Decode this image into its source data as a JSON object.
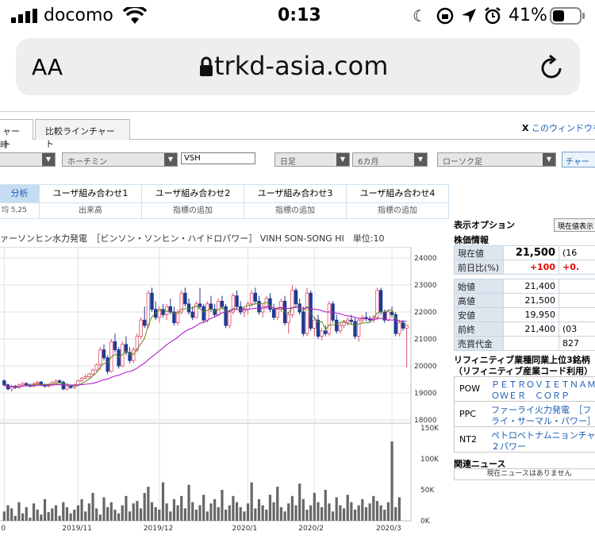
{
  "status": {
    "carrier": "docomo",
    "time": "0:13",
    "battery": "41%"
  },
  "browser": {
    "text_size": "AA",
    "host": "trkd-asia.com"
  },
  "page": {
    "tabs": [
      "ャート",
      "比較ラインチャート"
    ],
    "close_link": "このウィンドウを",
    "close_x": "X",
    "cut_label": "時",
    "market": "ホーチミン",
    "ticker": "VSH",
    "period": "日足",
    "range": "6カ月",
    "chart_style": "ローソク足",
    "chart_btn": "チャー",
    "indicator_tabs": [
      "分析",
      "ユーザ組み合わせ1",
      "ユーザ組み合わせ2",
      "ユーザ組み合わせ3",
      "ユーザ組み合わせ4"
    ],
    "indicator_sub": [
      "均 5,25",
      "出来高",
      "指標の追加",
      "指標の追加",
      "指標の追加"
    ],
    "chart_title": "ァーソンヒン水力発電　［ビンソン・ソンヒン・ハイドロパワー］ VINH SON-SONG HI　単位:10"
  },
  "side": {
    "display_options": "表示オプション",
    "current_value_btn": "現在値表示",
    "stock_info": "株価情報",
    "current_label": "現在値",
    "current_value": "21,500",
    "current_extra": "(16",
    "change_label": "前日比(%)",
    "change_value": "+100",
    "change_pct": "+0.",
    "rows": [
      {
        "k": "始値",
        "v": "21,400",
        "x": ""
      },
      {
        "k": "高値",
        "v": "21,500",
        "x": ""
      },
      {
        "k": "安値",
        "v": "19,950",
        "x": ""
      },
      {
        "k": "前終",
        "v": "21,400",
        "x": "(03"
      },
      {
        "k": "売買代金",
        "v": "",
        "x": "827"
      }
    ],
    "peers_title": "リフィニティブ業種同業上位3銘柄",
    "peers_sub": "（リフィニティブ産業コード利用）",
    "peers": [
      {
        "code": "POW",
        "name1": "ＰＥＴＲＯＶＩＥＴＮＡＭ",
        "name2": "ＯＷＥＲ　ＣＯＲＰ"
      },
      {
        "code": "PPC",
        "name1": "ファーライ火力発電　［フ",
        "name2": "ライ・サーマル・パワー］"
      },
      {
        "code": "NT2",
        "name1": "ペトロベトナムニョンチャ",
        "name2": "２パワー"
      }
    ],
    "news_title": "関連ニュース",
    "news_empty": "現在ニュースはありません"
  },
  "chart_data": {
    "type": "candlestick",
    "price_axis": {
      "ticks": [
        18000,
        19000,
        20000,
        21000,
        22000,
        23000,
        24000
      ],
      "labels": [
        "18000",
        "19000",
        "20000",
        "21000",
        "22000",
        "23000",
        "24000"
      ],
      "ylim": [
        18000,
        24000
      ]
    },
    "volume_axis": {
      "labels": [
        "0K",
        "50K",
        "100K",
        "150K"
      ],
      "ylim": [
        0,
        150000
      ]
    },
    "x_labels": [
      {
        "idx": 0,
        "label": "0"
      },
      {
        "idx": 20,
        "label": "2019/11"
      },
      {
        "idx": 42,
        "label": "2019/12"
      },
      {
        "idx": 66,
        "label": "2020/1"
      },
      {
        "idx": 84,
        "label": "2020/2"
      },
      {
        "idx": 105,
        "label": "2020/3"
      }
    ],
    "candles": [
      [
        19450,
        19500,
        19250,
        19300
      ],
      [
        19300,
        19350,
        19100,
        19150
      ],
      [
        19150,
        19300,
        19050,
        19250
      ],
      [
        19250,
        19300,
        19150,
        19200
      ],
      [
        19200,
        19350,
        19150,
        19300
      ],
      [
        19300,
        19400,
        19250,
        19350
      ],
      [
        19350,
        19400,
        19250,
        19300
      ],
      [
        19300,
        19350,
        19200,
        19250
      ],
      [
        19250,
        19400,
        19200,
        19350
      ],
      [
        19350,
        19450,
        19300,
        19400
      ],
      [
        19400,
        19450,
        19250,
        19300
      ],
      [
        19300,
        19350,
        19200,
        19250
      ],
      [
        19250,
        19350,
        19200,
        19300
      ],
      [
        19300,
        19450,
        19250,
        19400
      ],
      [
        19400,
        19500,
        19350,
        19450
      ],
      [
        19450,
        19500,
        19350,
        19400
      ],
      [
        19400,
        19450,
        19100,
        19150
      ],
      [
        19150,
        19300,
        19100,
        19250
      ],
      [
        19250,
        19300,
        19150,
        19200
      ],
      [
        19200,
        19350,
        19150,
        19300
      ],
      [
        19300,
        19500,
        19250,
        19450
      ],
      [
        19450,
        19600,
        19400,
        19550
      ],
      [
        19550,
        19700,
        19500,
        19600
      ],
      [
        19600,
        19750,
        19550,
        19700
      ],
      [
        19700,
        19900,
        19650,
        19850
      ],
      [
        19850,
        20100,
        19800,
        20050
      ],
      [
        20050,
        20700,
        19850,
        20600
      ],
      [
        20600,
        20800,
        20200,
        20300
      ],
      [
        20300,
        20400,
        19700,
        19800
      ],
      [
        19800,
        21000,
        19750,
        20900
      ],
      [
        20900,
        21200,
        20500,
        20600
      ],
      [
        20600,
        20700,
        19900,
        20000
      ],
      [
        20000,
        20900,
        19950,
        20800
      ],
      [
        20800,
        21100,
        20400,
        20500
      ],
      [
        20500,
        20700,
        20100,
        20200
      ],
      [
        20200,
        20700,
        20100,
        20600
      ],
      [
        20600,
        21200,
        20500,
        21100
      ],
      [
        21100,
        21800,
        21000,
        21700
      ],
      [
        21700,
        22200,
        21400,
        21500
      ],
      [
        21500,
        22800,
        21400,
        22700
      ],
      [
        22700,
        22900,
        22000,
        22100
      ],
      [
        22100,
        22400,
        21700,
        21800
      ],
      [
        21800,
        22200,
        21600,
        22100
      ],
      [
        22100,
        22300,
        21800,
        21900
      ],
      [
        21900,
        22300,
        21700,
        22200
      ],
      [
        22200,
        22500,
        21900,
        22000
      ],
      [
        22000,
        22200,
        21500,
        21600
      ],
      [
        21600,
        22100,
        21500,
        22000
      ],
      [
        22000,
        22800,
        21900,
        22700
      ],
      [
        22700,
        22900,
        22200,
        22300
      ],
      [
        22300,
        22500,
        21900,
        22000
      ],
      [
        22000,
        22200,
        21700,
        21800
      ],
      [
        21800,
        22400,
        21750,
        22300
      ],
      [
        22300,
        22900,
        22100,
        22200
      ],
      [
        22200,
        22300,
        21600,
        21700
      ],
      [
        21700,
        22400,
        21600,
        22300
      ],
      [
        22300,
        22600,
        22000,
        22100
      ],
      [
        22100,
        22300,
        21800,
        21900
      ],
      [
        21900,
        22500,
        21850,
        22400
      ],
      [
        22400,
        22600,
        22100,
        22200
      ],
      [
        22200,
        22300,
        21400,
        21500
      ],
      [
        21500,
        22100,
        21400,
        22000
      ],
      [
        22000,
        22700,
        21900,
        22600
      ],
      [
        22600,
        22800,
        22100,
        22200
      ],
      [
        22200,
        22400,
        21900,
        22000
      ],
      [
        22000,
        22200,
        21800,
        22100
      ],
      [
        22100,
        22400,
        21900,
        22300
      ],
      [
        22300,
        22800,
        22200,
        22700
      ],
      [
        22700,
        22900,
        22300,
        22400
      ],
      [
        22400,
        22600,
        21900,
        22000
      ],
      [
        22000,
        22300,
        21800,
        22200
      ],
      [
        22200,
        22600,
        22100,
        22500
      ],
      [
        22500,
        22700,
        22000,
        22100
      ],
      [
        22100,
        22300,
        21700,
        21800
      ],
      [
        21800,
        22200,
        21700,
        22100
      ],
      [
        22100,
        22500,
        22000,
        22400
      ],
      [
        22400,
        22600,
        21500,
        21600
      ],
      [
        21600,
        22000,
        21200,
        21900
      ],
      [
        21900,
        23000,
        21800,
        22800
      ],
      [
        22800,
        22900,
        22200,
        22300
      ],
      [
        22300,
        22500,
        21900,
        22000
      ],
      [
        22000,
        22200,
        21100,
        21200
      ],
      [
        21200,
        22900,
        21100,
        22700
      ],
      [
        22700,
        22800,
        21300,
        21400
      ],
      [
        21400,
        21800,
        21100,
        21700
      ],
      [
        21700,
        21900,
        21000,
        21100
      ],
      [
        21100,
        21400,
        20950,
        21300
      ],
      [
        21300,
        21500,
        21100,
        21200
      ],
      [
        21200,
        22400,
        21100,
        22300
      ],
      [
        22300,
        22400,
        21600,
        21700
      ],
      [
        21700,
        21900,
        21200,
        21300
      ],
      [
        21300,
        21600,
        21200,
        21500
      ],
      [
        21500,
        21700,
        21400,
        21600
      ],
      [
        21600,
        21800,
        21500,
        21700
      ],
      [
        21700,
        21900,
        21550,
        21650
      ],
      [
        21650,
        21800,
        21000,
        21100
      ],
      [
        21100,
        21800,
        20900,
        21700
      ],
      [
        21700,
        21900,
        21600,
        21800
      ],
      [
        21800,
        22000,
        21650,
        21750
      ],
      [
        21750,
        21850,
        21600,
        21700
      ],
      [
        21700,
        21900,
        21600,
        21800
      ],
      [
        21800,
        22900,
        21700,
        22800
      ],
      [
        22800,
        22900,
        21900,
        22000
      ],
      [
        22000,
        22100,
        21600,
        21700
      ],
      [
        21700,
        22100,
        21650,
        22000
      ],
      [
        22000,
        22200,
        21800,
        21900
      ],
      [
        21900,
        22000,
        21100,
        21200
      ],
      [
        21200,
        21700,
        21100,
        21600
      ],
      [
        21600,
        21700,
        21300,
        21400
      ],
      [
        21400,
        21500,
        19950,
        21500
      ]
    ],
    "volumes": [
      15,
      25,
      20,
      8,
      30,
      12,
      22,
      5,
      28,
      18,
      10,
      35,
      14,
      20,
      25,
      8,
      30,
      22,
      12,
      18,
      25,
      35,
      15,
      28,
      45,
      20,
      10,
      38,
      22,
      30,
      18,
      12,
      25,
      40,
      15,
      28,
      32,
      20,
      45,
      55,
      30,
      22,
      18,
      62,
      28,
      15,
      35,
      25,
      40,
      20,
      58,
      30,
      18,
      25,
      42,
      15,
      28,
      35,
      22,
      50,
      18,
      25,
      40,
      30,
      22,
      15,
      28,
      62,
      20,
      35,
      25,
      18,
      42,
      30,
      55,
      22,
      15,
      28,
      40,
      25,
      60,
      35,
      18,
      25,
      45,
      30,
      22,
      50,
      28,
      15,
      38,
      25,
      20,
      42,
      30,
      18,
      25,
      35,
      22,
      28,
      40,
      32,
      25,
      18,
      30,
      128,
      22,
      38
    ]
  }
}
